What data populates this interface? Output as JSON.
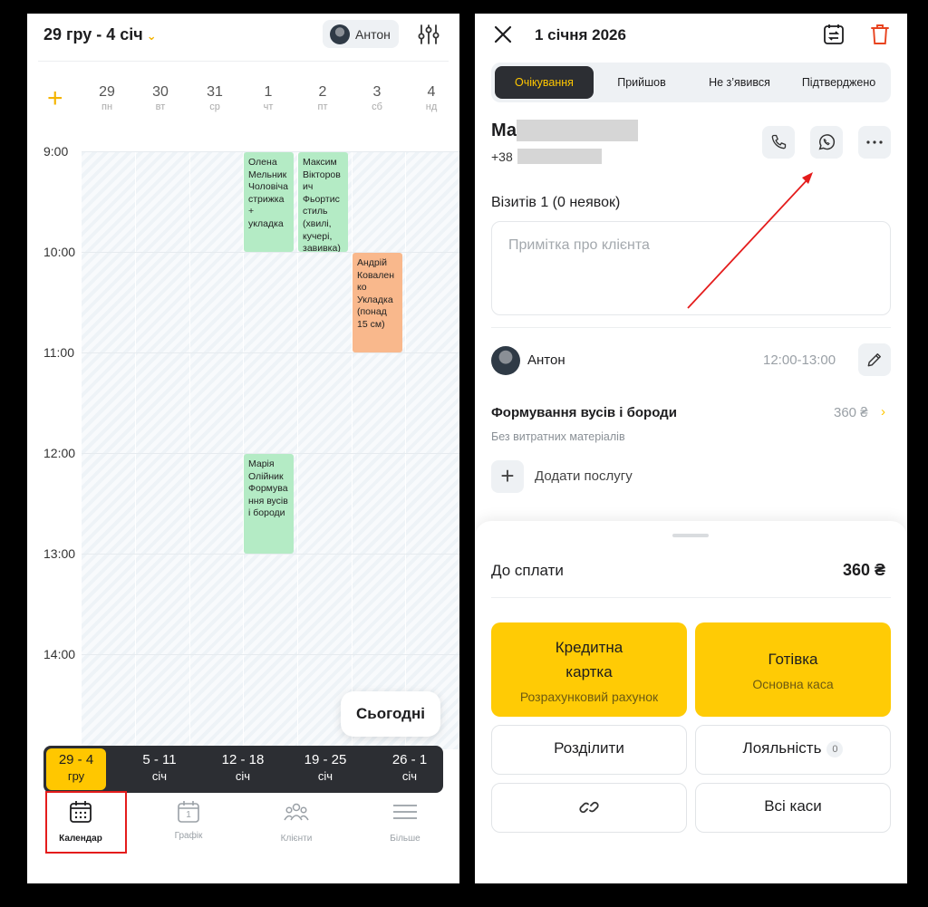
{
  "calendar": {
    "date_range": "29 гру - 4 січ",
    "staff": "Антон",
    "days": [
      {
        "num": "29",
        "wd": "пн"
      },
      {
        "num": "30",
        "wd": "вт"
      },
      {
        "num": "31",
        "wd": "ср"
      },
      {
        "num": "1",
        "wd": "чт"
      },
      {
        "num": "2",
        "wd": "пт"
      },
      {
        "num": "3",
        "wd": "сб"
      },
      {
        "num": "4",
        "wd": "нд"
      }
    ],
    "times": [
      "9:00",
      "10:00",
      "11:00",
      "12:00",
      "13:00",
      "14:00"
    ],
    "appointments": [
      {
        "text": "Олена Мельник Чоловіча стрижка + укладка",
        "day": "1"
      },
      {
        "text": "Максим Вікторович Фьортис стиль (хвилі, кучері, завивка)",
        "day": "2"
      },
      {
        "text": "Андрій Коваленко Укладка (понад 15 см)",
        "day": "3"
      },
      {
        "text": "Марія Олійник Формування вусів і бороди",
        "day": "1"
      }
    ],
    "today_button": "Сьогодні",
    "weeks": [
      {
        "l1": "29 - 4",
        "l2": "гру"
      },
      {
        "l1": "5 - 11",
        "l2": "січ"
      },
      {
        "l1": "12 - 18",
        "l2": "січ"
      },
      {
        "l1": "19 - 25",
        "l2": "січ"
      },
      {
        "l1": "26 - 1",
        "l2": "січ"
      }
    ],
    "tabs": {
      "calendar": "Календар",
      "schedule": "Графік",
      "clients": "Клієнти",
      "more": "Більше"
    },
    "schedule_icon_digit": "1"
  },
  "appointment": {
    "title": "1 січня 2026",
    "statuses": [
      "Очікування",
      "Прийшов",
      "Не з’явився",
      "Підтверджено"
    ],
    "active_status": "Очікування",
    "client_name_visible": "Ма",
    "client_phone_visible": "+38",
    "visits": "Візитів 1 (0 неявок)",
    "note_placeholder": "Примітка про клієнта",
    "master": {
      "name": "Антон",
      "time": "12:00-13:00"
    },
    "service": {
      "name": "Формування вусів і бороди",
      "price": "360 ₴",
      "sub": "Без витратних матеріалів"
    },
    "add_service": "Додати послугу",
    "payment": {
      "label": "До сплати",
      "total": "360 ₴",
      "card_l1": "Кредитна",
      "card_l2": "картка",
      "card_sub": "Розрахунковий рахунок",
      "cash": "Готівка",
      "cash_sub": "Основна каса",
      "split": "Розділити",
      "loyalty": "Лояльність",
      "loyalty_count": "0",
      "all_registers": "Всі каси"
    }
  },
  "colors": {
    "accent": "#ffc700",
    "green_appt": "#b4ebc5",
    "orange_appt": "#f9b88c",
    "annotation": "#e41c1c"
  },
  "icons": [
    "filter-icon",
    "close-icon",
    "calendar-sync-icon",
    "trash-icon",
    "phone-icon",
    "whatsapp-icon",
    "more-icon",
    "pencil-icon",
    "plus-icon",
    "link-icon",
    "calendar-icon",
    "clients-icon",
    "menu-icon"
  ]
}
